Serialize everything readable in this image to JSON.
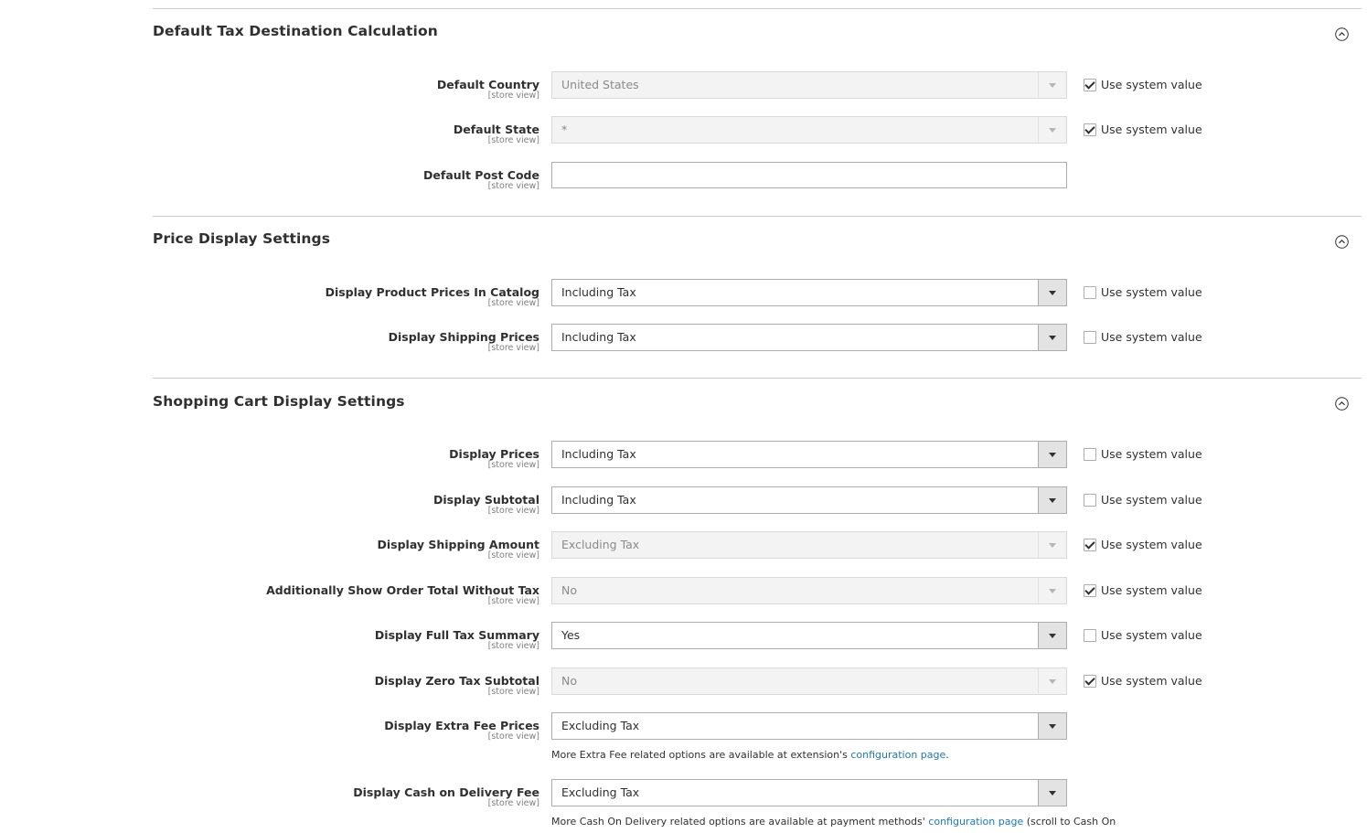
{
  "system_value_label": "Use system value",
  "sections": [
    {
      "title": "Default Tax Destination Calculation",
      "fields": [
        {
          "label": "Default Country",
          "scope": "[store view]",
          "type": "select",
          "value": "United States",
          "disabled": true,
          "use_system": true
        },
        {
          "label": "Default State",
          "scope": "[store view]",
          "type": "select",
          "value": "*",
          "disabled": true,
          "use_system": true
        },
        {
          "label": "Default Post Code",
          "scope": "[store view]",
          "type": "text",
          "value": ""
        }
      ]
    },
    {
      "title": "Price Display Settings",
      "fields": [
        {
          "label": "Display Product Prices In Catalog",
          "scope": "[store view]",
          "type": "select",
          "value": "Including Tax",
          "disabled": false,
          "use_system": false
        },
        {
          "label": "Display Shipping Prices",
          "scope": "[store view]",
          "type": "select",
          "value": "Including Tax",
          "disabled": false,
          "use_system": false
        }
      ]
    },
    {
      "title": "Shopping Cart Display Settings",
      "fields": [
        {
          "label": "Display Prices",
          "scope": "[store view]",
          "type": "select",
          "value": "Including Tax",
          "disabled": false,
          "use_system": false
        },
        {
          "label": "Display Subtotal",
          "scope": "[store view]",
          "type": "select",
          "value": "Including Tax",
          "disabled": false,
          "use_system": false
        },
        {
          "label": "Display Shipping Amount",
          "scope": "[store view]",
          "type": "select",
          "value": "Excluding Tax",
          "disabled": true,
          "use_system": true
        },
        {
          "label": "Additionally Show Order Total Without Tax",
          "scope": "[store view]",
          "type": "select",
          "value": "No",
          "disabled": true,
          "use_system": true
        },
        {
          "label": "Display Full Tax Summary",
          "scope": "[store view]",
          "type": "select",
          "value": "Yes",
          "disabled": false,
          "use_system": false
        },
        {
          "label": "Display Zero Tax Subtotal",
          "scope": "[store view]",
          "type": "select",
          "value": "No",
          "disabled": true,
          "use_system": true
        },
        {
          "label": "Display Extra Fee Prices",
          "scope": "[store view]",
          "type": "select",
          "value": "Excluding Tax",
          "disabled": false,
          "note": {
            "text": "More Extra Fee related options are available at extension's ",
            "link": "configuration page",
            "after": "."
          }
        },
        {
          "label": "Display Cash on Delivery Fee",
          "scope": "[store view]",
          "type": "select",
          "value": "Excluding Tax",
          "disabled": false,
          "note": {
            "text": "More Cash On Delivery related options are available at payment methods' ",
            "link": "configuration page",
            "after": " (scroll to Cash On"
          }
        }
      ]
    }
  ],
  "colors": {
    "link": "#1979c3",
    "text": "#303030",
    "scope": "#808080",
    "divider": "#cccccc"
  },
  "icons": {
    "collapse": "chevron-up-circle-icon",
    "dropdown": "chevron-down-icon",
    "check": "check-icon"
  }
}
